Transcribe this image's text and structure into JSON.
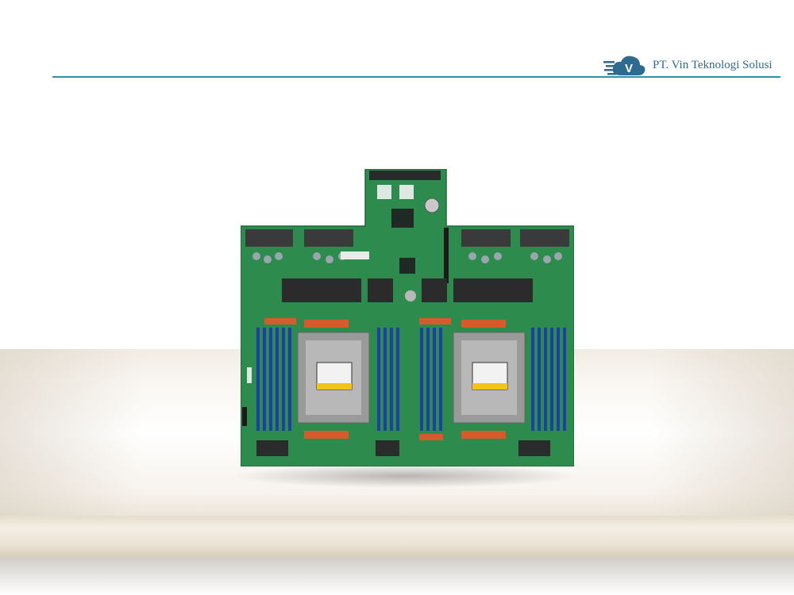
{
  "brand": {
    "name": "PT. Vin Teknologi Solusi",
    "logo_letter": "V",
    "color": "#2f6b8f"
  },
  "accent_rule_color": "#2a93a8",
  "image": {
    "subject": "server motherboard",
    "board_color": "#2e8b4e",
    "dimm_color": "#1f3fa8"
  }
}
